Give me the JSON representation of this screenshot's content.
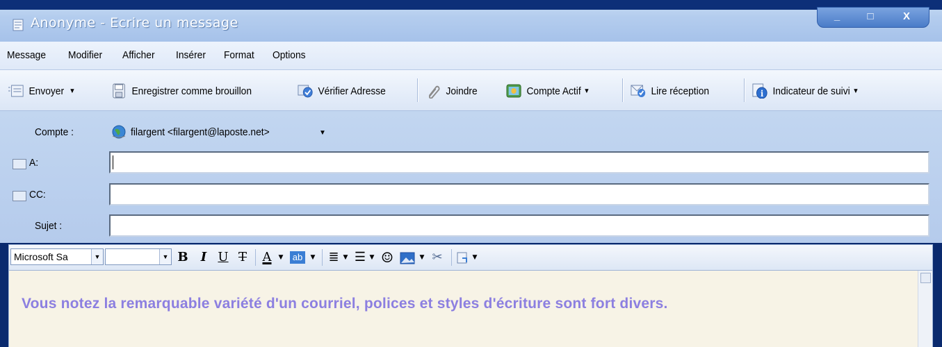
{
  "window": {
    "title": "Anonyme - Ecrire un message",
    "controls": {
      "minimize": "_",
      "maximize": "□",
      "close": "X"
    }
  },
  "menu": [
    "Message",
    "Modifier",
    "Afficher",
    "Insérer",
    "Format",
    "Options"
  ],
  "toolbar": {
    "send": "Envoyer",
    "save_draft": "Enregistrer comme brouillon",
    "check_address": "Vérifier Adresse",
    "attach": "Joindre",
    "active_account": "Compte Actif",
    "read_receipt": "Lire réception",
    "followup": "Indicateur de suivi"
  },
  "header": {
    "account_label": "Compte :",
    "account_value": "filargent <filargent@laposte.net>",
    "to_label": "A:",
    "to_value": "",
    "cc_label": "CC:",
    "cc_value": "",
    "subject_label": "Sujet :",
    "subject_value": ""
  },
  "format": {
    "font_name": "Microsoft Sa",
    "font_size": "",
    "bold": "B",
    "italic": "I",
    "underline": "U",
    "strike": "T",
    "font_color": "A",
    "highlight": "ab"
  },
  "editor": {
    "text": "Vous notez la remarquable variété d'un courriel, polices et styles d'écriture sont fort divers.",
    "text_color": "#8c7fe0"
  }
}
